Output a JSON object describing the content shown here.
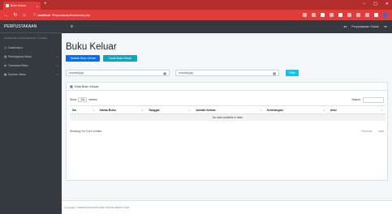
{
  "browser": {
    "tab_title": "Buku Keluar",
    "url_host": "localhost",
    "url_path": "/Perpustakaan/bukukeluar.php"
  },
  "sidebar": {
    "brand": "PERPUSTAKAAN",
    "subtitle": "INVENTORY MANAGEMENT SYSTEM",
    "items": [
      {
        "label": "Dashboard",
        "icon": "gauge-icon"
      },
      {
        "label": "Peminjaman Buku",
        "icon": "book-icon"
      },
      {
        "label": "Transaksi Buku",
        "icon": "exchange-icon"
      },
      {
        "label": "Sumber Buku",
        "icon": "folder-icon"
      }
    ]
  },
  "topnav": {
    "user_label": "Perpustakaan Stradu"
  },
  "main": {
    "title": "Buku Keluar",
    "btn_add": "Tambah Buku Keluar",
    "btn_print": "Cetak Buku Keluar",
    "date_start_placeholder": "mm/dd/yyyy",
    "date_end_placeholder": "mm/dd/yyyy",
    "btn_filter": "Filter"
  },
  "table_card": {
    "title": "Data Buku Keluar",
    "show_label": "Show",
    "entries_value": "10",
    "entries_label": "entries",
    "search_label": "Search:",
    "columns": [
      "No",
      "Nama Buku",
      "Tanggal",
      "Jumlah Keluar",
      "Keterangan",
      "Aksi"
    ],
    "empty_message": "No data available in table",
    "info": "Showing 0 to 0 of 0 entries",
    "prev": "Previous",
    "next": "Next"
  },
  "footer": {
    "text": "Copyright © PERPUSTAKAAN SMP STRADA BAKTI 2023"
  },
  "colors": {
    "browser_red": "#e23b3b",
    "sidebar_dark": "#343a40",
    "primary_blue": "#0a6fe0",
    "info_cyan": "#17a2b8"
  }
}
